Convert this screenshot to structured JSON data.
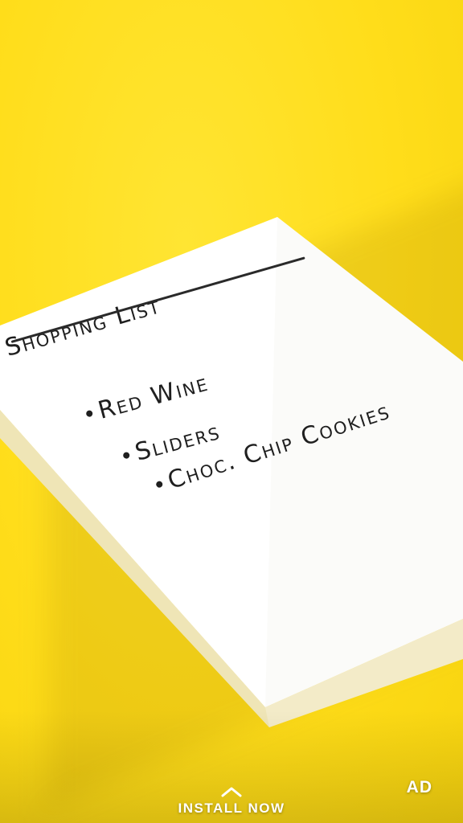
{
  "notepad": {
    "title": "Shopping List",
    "items": [
      {
        "label": "Red Wine"
      },
      {
        "label": "Sliders"
      },
      {
        "label": "Choc. Chip Cookies"
      }
    ]
  },
  "cta": {
    "label": "INSTALL NOW",
    "icon": "chevron-up-icon"
  },
  "ad_badge": "AD",
  "colors": {
    "background": "#FFDD1A",
    "paper": "#FFFFFF",
    "ink": "#1F1F1F",
    "overlay_text": "#FFFFFF"
  }
}
